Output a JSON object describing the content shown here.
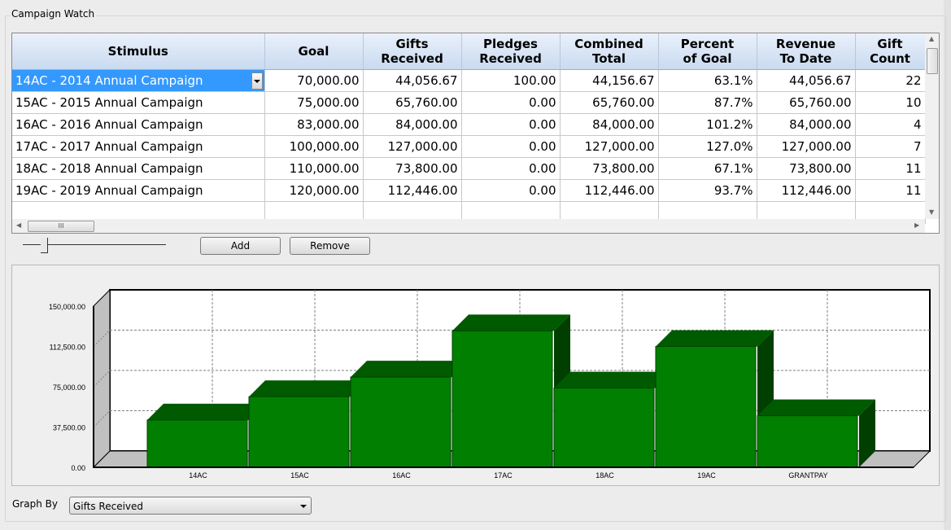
{
  "group_title": "Campaign Watch",
  "table": {
    "columns": [
      "Stimulus",
      "Goal",
      "Gifts\nReceived",
      "Pledges\nReceived",
      "Combined\nTotal",
      "Percent\nof Goal",
      "Revenue\nTo Date",
      "Gift\nCount"
    ],
    "rows": [
      [
        "14AC - 2014 Annual Campaign",
        "70,000.00",
        "44,056.67",
        "100.00",
        "44,156.67",
        "63.1%",
        "44,056.67",
        "22"
      ],
      [
        "15AC - 2015 Annual Campaign",
        "75,000.00",
        "65,760.00",
        "0.00",
        "65,760.00",
        "87.7%",
        "65,760.00",
        "10"
      ],
      [
        "16AC - 2016 Annual Campaign",
        "83,000.00",
        "84,000.00",
        "0.00",
        "84,000.00",
        "101.2%",
        "84,000.00",
        "4"
      ],
      [
        "17AC - 2017 Annual Campaign",
        "100,000.00",
        "127,000.00",
        "0.00",
        "127,000.00",
        "127.0%",
        "127,000.00",
        "7"
      ],
      [
        "18AC - 2018 Annual Campaign",
        "110,000.00",
        "73,800.00",
        "0.00",
        "73,800.00",
        "67.1%",
        "73,800.00",
        "11"
      ],
      [
        "19AC - 2019 Annual Campaign",
        "120,000.00",
        "112,446.00",
        "0.00",
        "112,446.00",
        "93.7%",
        "112,446.00",
        "11"
      ]
    ],
    "selected_row": 0,
    "hscroll_thumb_glyph": "III"
  },
  "buttons": {
    "add": "Add",
    "remove": "Remove"
  },
  "graph_by": {
    "label": "Graph By",
    "selected": "Gifts Received"
  },
  "colors": {
    "bar_front": "#007f00",
    "bar_top": "#005a00",
    "bar_side": "#003f00",
    "selection": "#3399ff"
  },
  "chart_data": {
    "type": "bar",
    "style": "3d",
    "categories": [
      "14AC",
      "15AC",
      "16AC",
      "17AC",
      "18AC",
      "19AC",
      "GRANTPAY"
    ],
    "values": [
      44056.67,
      65760,
      84000,
      127000,
      73800,
      112446,
      48000
    ],
    "series_name": "Gifts Received",
    "yticks": [
      "0.00",
      "37,500.00",
      "75,000.00",
      "112,500.00",
      "150,000.00"
    ],
    "ylim": [
      0,
      150000
    ],
    "grid": true,
    "title": "",
    "xlabel": "",
    "ylabel": ""
  }
}
